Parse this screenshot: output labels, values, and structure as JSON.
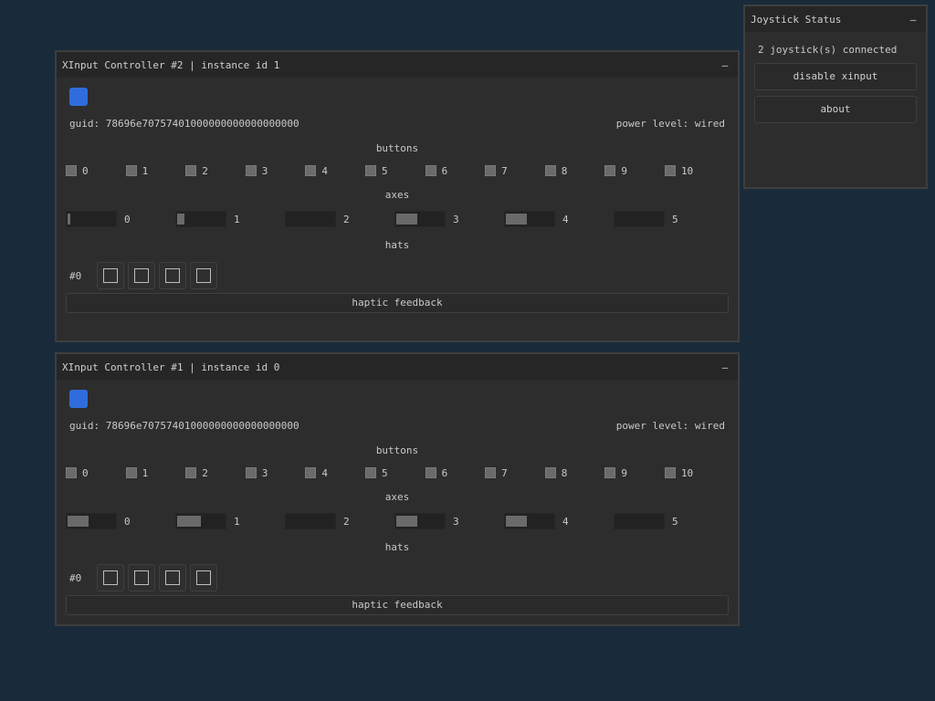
{
  "status_window": {
    "title": "Joystick Status",
    "minimize": "–",
    "connected_text": "2 joystick(s) connected",
    "disable_xinput_label": "disable xinput",
    "about_label": "about"
  },
  "controllers": [
    {
      "title": "XInput Controller #2 | instance id 1",
      "minimize": "–",
      "led_color": "#2f6ddc",
      "guid_text": "guid: 78696e70757401000000000000000000",
      "power_text": "power level: wired",
      "buttons_title": "buttons",
      "buttons": [
        "0",
        "1",
        "2",
        "3",
        "4",
        "5",
        "6",
        "7",
        "8",
        "9",
        "10"
      ],
      "axes_title": "axes",
      "axes": [
        {
          "label": "0",
          "value": 0.05
        },
        {
          "label": "1",
          "value": 0.15
        },
        {
          "label": "2",
          "value": 0.0
        },
        {
          "label": "3",
          "value": 0.45
        },
        {
          "label": "4",
          "value": 0.45
        },
        {
          "label": "5",
          "value": 0.0
        }
      ],
      "hats_title": "hats",
      "hat_label": "#0",
      "haptic_label": "haptic feedback"
    },
    {
      "title": "XInput Controller #1 | instance id 0",
      "minimize": "–",
      "led_color": "#2f6ddc",
      "guid_text": "guid: 78696e70757401000000000000000000",
      "power_text": "power level: wired",
      "buttons_title": "buttons",
      "buttons": [
        "0",
        "1",
        "2",
        "3",
        "4",
        "5",
        "6",
        "7",
        "8",
        "9",
        "10"
      ],
      "axes_title": "axes",
      "axes": [
        {
          "label": "0",
          "value": 0.45
        },
        {
          "label": "1",
          "value": 0.5
        },
        {
          "label": "2",
          "value": 0.0
        },
        {
          "label": "3",
          "value": 0.45
        },
        {
          "label": "4",
          "value": 0.45
        },
        {
          "label": "5",
          "value": 0.0
        }
      ],
      "hats_title": "hats",
      "hat_label": "#0",
      "haptic_label": "haptic feedback"
    }
  ]
}
